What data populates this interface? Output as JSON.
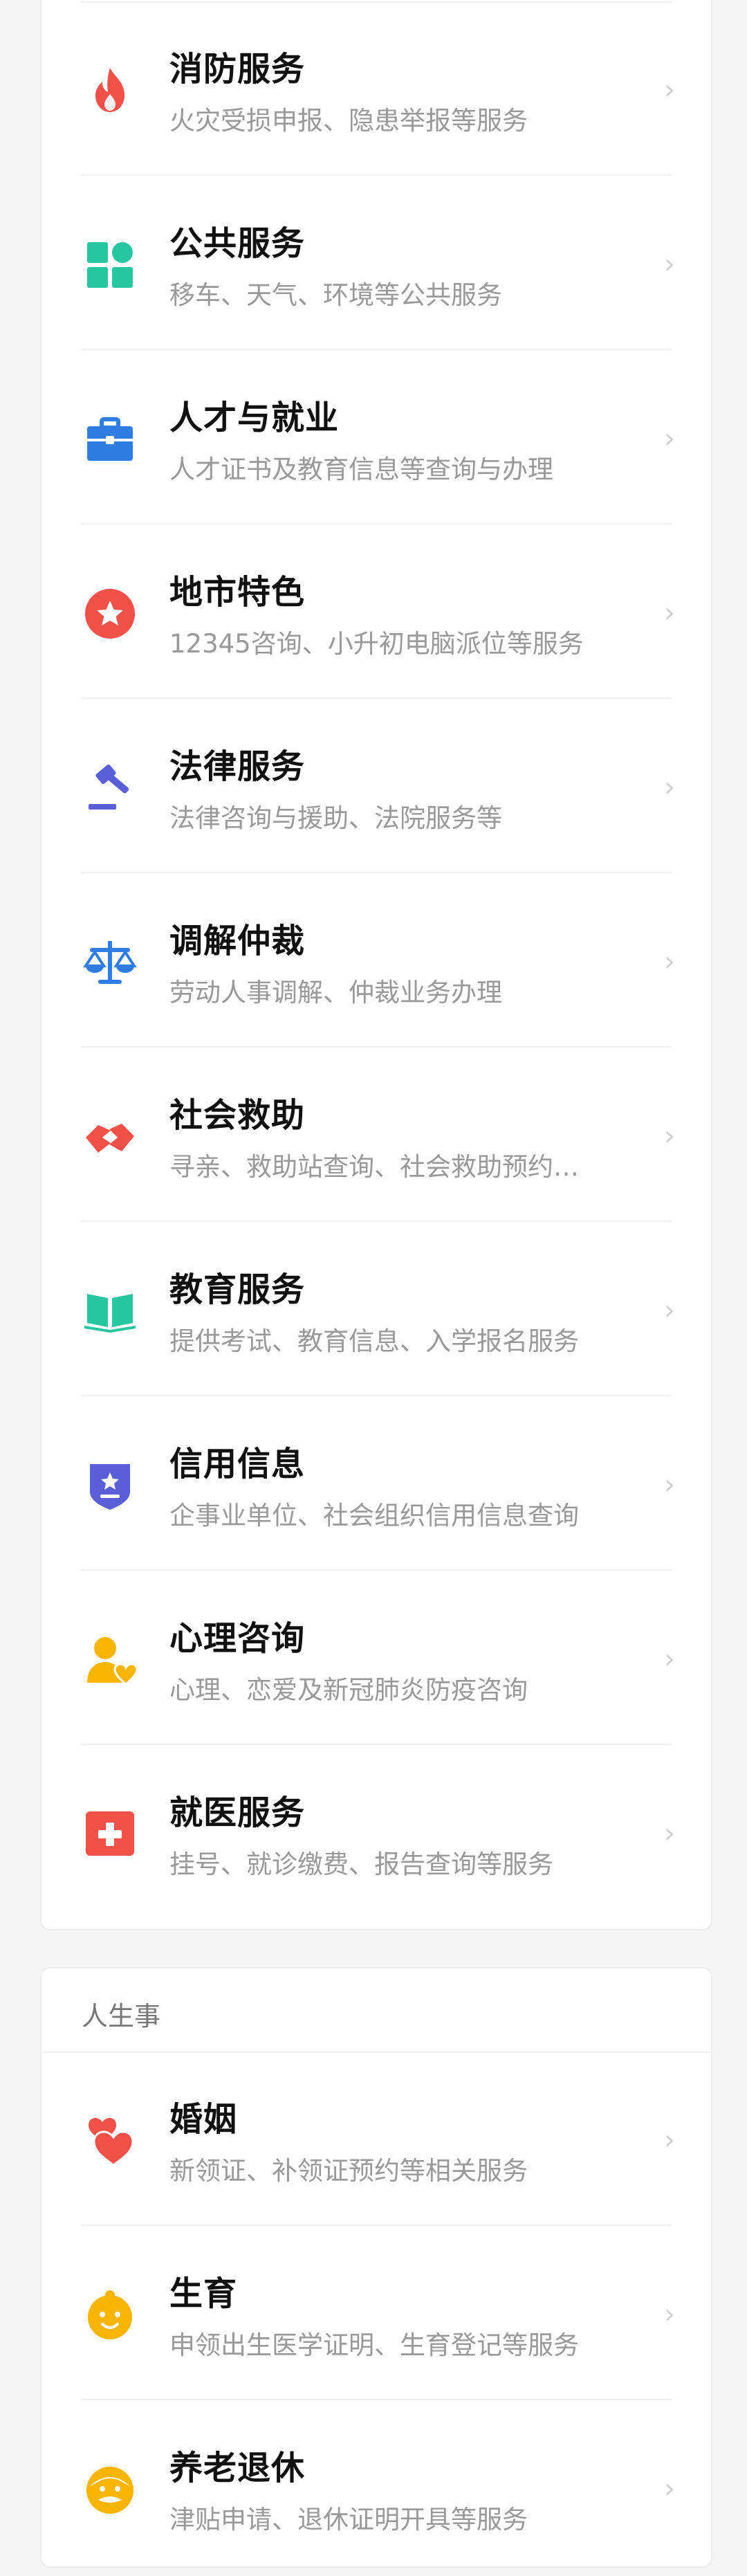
{
  "chevron": "›",
  "services": [
    {
      "title": "消防服务",
      "desc": "火灾受损申报、隐患举报等服务",
      "icon": "flame-icon"
    },
    {
      "title": "公共服务",
      "desc": "移车、天气、环境等公共服务",
      "icon": "grid-blocks-icon"
    },
    {
      "title": "人才与就业",
      "desc": "人才证书及教育信息等查询与办理",
      "icon": "briefcase-icon"
    },
    {
      "title": "地市特色",
      "desc": "12345咨询、小升初电脑派位等服务",
      "icon": "star-badge-icon"
    },
    {
      "title": "法律服务",
      "desc": "法律咨询与援助、法院服务等",
      "icon": "gavel-icon"
    },
    {
      "title": "调解仲裁",
      "desc": "劳动人事调解、仲裁业务办理",
      "icon": "scales-icon"
    },
    {
      "title": "社会救助",
      "desc": "寻亲、救助站查询、社会救助预约…",
      "icon": "handshake-icon"
    },
    {
      "title": "教育服务",
      "desc": "提供考试、教育信息、入学报名服务",
      "icon": "book-icon"
    },
    {
      "title": "信用信息",
      "desc": "企事业单位、社会组织信用信息查询",
      "icon": "credit-shield-icon"
    },
    {
      "title": "心理咨询",
      "desc": "心理、恋爱及新冠肺炎防疫咨询",
      "icon": "person-heart-icon"
    },
    {
      "title": "就医服务",
      "desc": "挂号、就诊缴费、报告查询等服务",
      "icon": "medical-cross-icon"
    }
  ],
  "life": {
    "section_title": "人生事",
    "items": [
      {
        "title": "婚姻",
        "desc": "新领证、补领证预约等相关服务",
        "icon": "double-heart-icon"
      },
      {
        "title": "生育",
        "desc": "申领出生医学证明、生育登记等服务",
        "icon": "baby-face-icon"
      },
      {
        "title": "养老退休",
        "desc": "津贴申请、退休证明开具等服务",
        "icon": "elder-face-icon"
      }
    ]
  },
  "colors": {
    "fire": "#f0524a",
    "teal": "#27c6a0",
    "blue": "#2f7de1",
    "indigo": "#5a5fd8",
    "yellow": "#f7b500"
  }
}
